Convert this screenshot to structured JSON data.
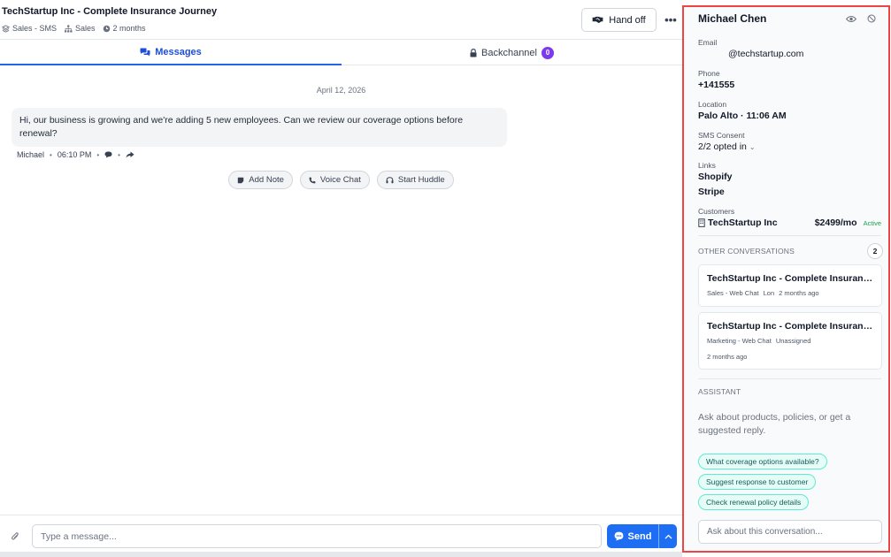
{
  "conversation": {
    "title": "TechStartup Inc - Complete Insurance Journey",
    "meta": {
      "channel": "Sales - SMS",
      "team": "Sales",
      "age": "2 months"
    },
    "handoff_label": "Hand off",
    "more_label": "•••"
  },
  "tabs": {
    "messages": "Messages",
    "backchannel": "Backchannel",
    "backchannel_count": "0"
  },
  "thread": {
    "date": "April 12, 2026",
    "message": {
      "text": "Hi, our business is growing and we're adding 5 new employees. Can we review our coverage options before renewal?",
      "author": "Michael",
      "time": "06:10 PM"
    },
    "actions": {
      "add_note": "Add Note",
      "voice_chat": "Voice Chat",
      "start_huddle": "Start Huddle"
    }
  },
  "composer": {
    "placeholder": "Type a message...",
    "send_label": "Send"
  },
  "contact": {
    "name": "Michael Chen",
    "email_label": "Email",
    "email": "@techstartup.com",
    "phone_label": "Phone",
    "phone": "+141555",
    "location_label": "Location",
    "location": "Palo Alto · 11:06 AM",
    "sms_label": "SMS Consent",
    "sms_value": "2/2 opted in",
    "links_label": "Links",
    "links": [
      "Shopify",
      "Stripe"
    ],
    "customers_label": "Customers",
    "customer": {
      "name": "TechStartup Inc",
      "amount": "$2499/mo",
      "status": "Active"
    }
  },
  "other_conversations": {
    "title": "OTHER CONVERSATIONS",
    "count": "2",
    "items": [
      {
        "title": "TechStartup Inc - Complete Insuranc...",
        "channel": "Sales - Web Chat",
        "assignee": "Lon",
        "age": "2 months ago"
      },
      {
        "title": "TechStartup Inc - Complete Insuranc...",
        "channel": "Marketing - Web Chat",
        "assignee": "Unassigned",
        "age": "2 months ago"
      }
    ]
  },
  "assistant": {
    "title": "ASSISTANT",
    "hint": "Ask about products, policies, or get a suggested reply.",
    "suggestions": [
      "What coverage options available?",
      "Suggest response to customer",
      "Check renewal policy details"
    ],
    "placeholder": "Ask about this conversation..."
  },
  "colors": {
    "accent": "#1d6ef2",
    "badge": "#7c3aed",
    "sidebar_border": "#ef4444",
    "active": "#16a34a"
  }
}
